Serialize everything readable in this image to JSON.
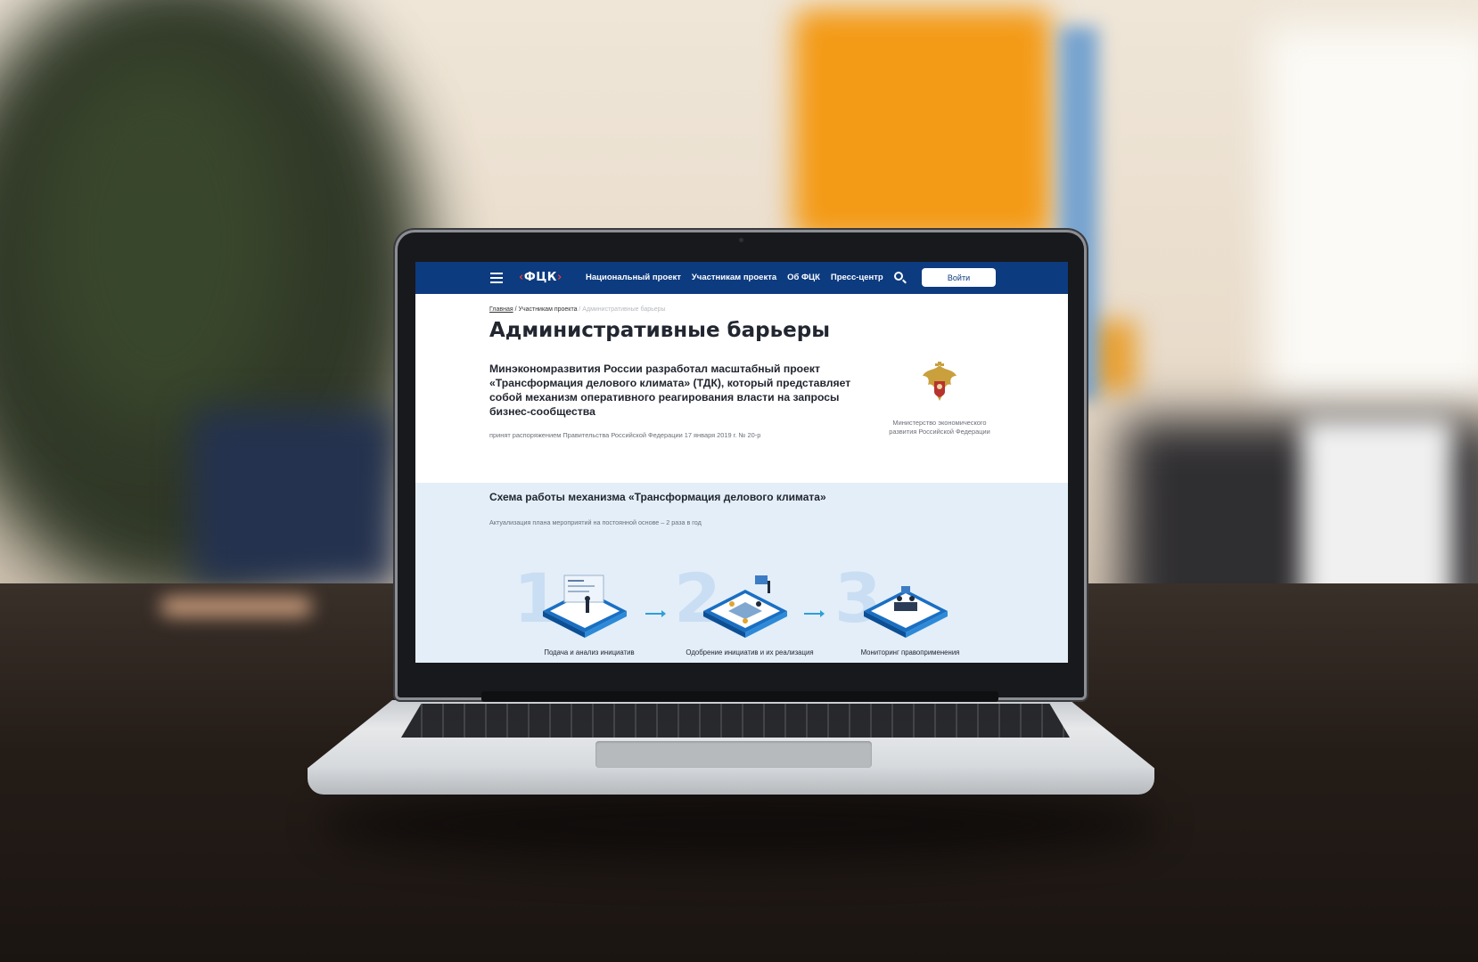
{
  "header": {
    "logo": "ФЦК",
    "nav": [
      "Национальный проект",
      "Участникам проекта",
      "Об ФЦК",
      "Пресс-центр"
    ],
    "login_label": "Войти"
  },
  "breadcrumb": {
    "home": "Главная",
    "section": "/ Участникам проекта",
    "current": "/ Административные барьеры"
  },
  "page": {
    "title": "Административные барьеры",
    "lead": "Минэкономразвития России разработал масштабный проект «Трансформация делового климата» (ТДК), который представляет собой механизм оперативного реагирования власти на запросы бизнес-сообщества",
    "decree": "принят распоряжением Правительства Российской Федерации 17 января 2019 г. № 20-р",
    "ministry": "Министерство экономического развития Российской Федерации"
  },
  "scheme": {
    "title": "Схема работы механизма «Трансформация делового климата»",
    "subtitle": "Актуализация плана мероприятий на постоянной основе – 2 раза в год",
    "steps": [
      {
        "num": "1",
        "label": "Подача и анализ инициатив"
      },
      {
        "num": "2",
        "label": "Одобрение инициатив и их реализация"
      },
      {
        "num": "3",
        "label": "Мониторинг правоприменения"
      }
    ]
  },
  "colors": {
    "header_bg": "#0d3b7f",
    "scheme_bg": "#e3eef9",
    "accent_arrow": "#2e9fd6",
    "logo_bracket": "#e23b3b"
  }
}
